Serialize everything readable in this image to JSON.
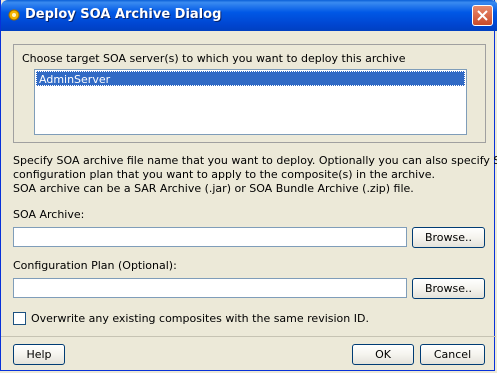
{
  "window": {
    "title": "Deploy SOA Archive Dialog",
    "icons": {
      "app": "gear-icon",
      "close": "close-icon"
    }
  },
  "servers": {
    "label": "Choose target SOA server(s) to which you want to deploy this archive",
    "items": [
      "AdminServer"
    ]
  },
  "description": {
    "line1": "Specify SOA archive file name that you want to deploy. Optionally you can also specify SOA",
    "line2": "configuration plan that you want to apply to the composite(s) in the archive.",
    "line3": "SOA archive can be a SAR Archive (.jar) or SOA Bundle Archive (.zip) file."
  },
  "soa_archive": {
    "label": "SOA Archive:",
    "value": "",
    "browse_label": "Browse.."
  },
  "config_plan": {
    "label": "Configuration Plan (Optional):",
    "value": "",
    "browse_label": "Browse.."
  },
  "overwrite": {
    "label": "Overwrite any existing composites with the same revision ID.",
    "checked": false
  },
  "footer": {
    "help_label": "Help",
    "ok_label": "OK",
    "cancel_label": "Cancel"
  },
  "colors": {
    "titlebar": "#0058e6",
    "selection": "#316ac5",
    "dialog_bg": "#ece9d8"
  }
}
